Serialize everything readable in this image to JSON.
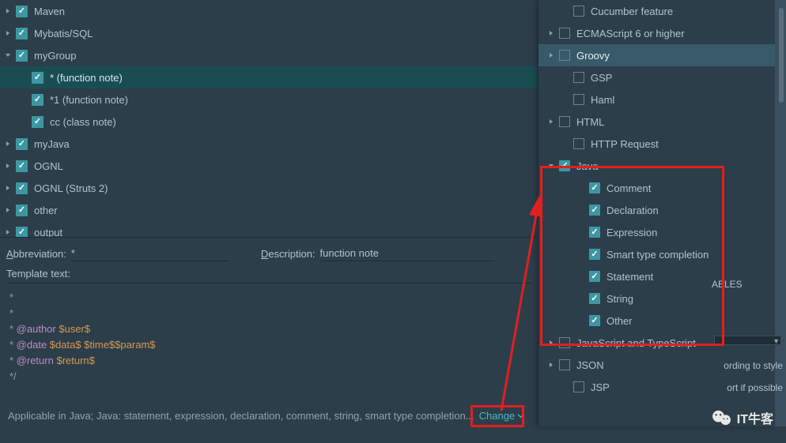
{
  "tree": {
    "items": [
      {
        "label": "Maven",
        "checked": true,
        "hasChevron": true,
        "expanded": false,
        "indent": 0
      },
      {
        "label": "Mybatis/SQL",
        "checked": true,
        "hasChevron": true,
        "expanded": false,
        "indent": 0
      },
      {
        "label": "myGroup",
        "checked": true,
        "hasChevron": true,
        "expanded": true,
        "indent": 0
      },
      {
        "label": "* (function note)",
        "checked": true,
        "hasChevron": false,
        "indent": 1,
        "selected": true
      },
      {
        "label": "*1 (function note)",
        "checked": true,
        "hasChevron": false,
        "indent": 1
      },
      {
        "label": "cc (class note)",
        "checked": true,
        "hasChevron": false,
        "indent": 1
      },
      {
        "label": "myJava",
        "checked": true,
        "hasChevron": true,
        "expanded": false,
        "indent": 0
      },
      {
        "label": "OGNL",
        "checked": true,
        "hasChevron": true,
        "expanded": false,
        "indent": 0
      },
      {
        "label": "OGNL (Struts 2)",
        "checked": true,
        "hasChevron": true,
        "expanded": false,
        "indent": 0
      },
      {
        "label": "other",
        "checked": true,
        "hasChevron": true,
        "expanded": false,
        "indent": 0
      },
      {
        "label": "output",
        "checked": true,
        "hasChevron": true,
        "expanded": false,
        "indent": 0
      }
    ]
  },
  "form": {
    "abbreviation_label_pre": "A",
    "abbreviation_label_post": "bbreviation:",
    "abbreviation_value": "*",
    "description_label_pre": "D",
    "description_label_post": "escription:",
    "description_value": "function note",
    "template_label_pre": "T",
    "template_label_post": "emplate text:"
  },
  "template_lines": [
    {
      "parts": [
        {
          "t": "*",
          "c": "pl-comment"
        }
      ]
    },
    {
      "parts": [
        {
          "t": " *",
          "c": "pl-comment"
        }
      ]
    },
    {
      "parts": [
        {
          "t": " * ",
          "c": "pl-comment"
        },
        {
          "t": "@author",
          "c": "pl-tag"
        },
        {
          "t": " ",
          "c": ""
        },
        {
          "t": "$user$",
          "c": "pl-var"
        }
      ]
    },
    {
      "parts": [
        {
          "t": " * ",
          "c": "pl-comment"
        },
        {
          "t": "@date",
          "c": "pl-tag"
        },
        {
          "t": " ",
          "c": ""
        },
        {
          "t": "$data$ $time$$param$",
          "c": "pl-var"
        }
      ]
    },
    {
      "parts": [
        {
          "t": " * ",
          "c": "pl-comment"
        },
        {
          "t": "@return",
          "c": "pl-tag"
        },
        {
          "t": " ",
          "c": ""
        },
        {
          "t": "$return$",
          "c": "pl-var"
        }
      ]
    },
    {
      "parts": [
        {
          "t": " */",
          "c": "pl-comment"
        }
      ]
    }
  ],
  "applicable": {
    "text": "Applicable in Java; Java: statement, expression, declaration, comment, string, smart type completion...",
    "change": "Change"
  },
  "popup": {
    "items": [
      {
        "label": "Cucumber feature",
        "checked": false,
        "hasChevron": false,
        "indent": 1
      },
      {
        "label": "ECMAScript 6 or higher",
        "checked": false,
        "hasChevron": true,
        "indent": 0
      },
      {
        "label": "Groovy",
        "checked": false,
        "hasChevron": true,
        "indent": 0,
        "selected": true
      },
      {
        "label": "GSP",
        "checked": false,
        "hasChevron": false,
        "indent": 1
      },
      {
        "label": "Haml",
        "checked": false,
        "hasChevron": false,
        "indent": 1
      },
      {
        "label": "HTML",
        "checked": false,
        "hasChevron": true,
        "indent": 0
      },
      {
        "label": "HTTP Request",
        "checked": false,
        "hasChevron": false,
        "indent": 1
      },
      {
        "label": "Java",
        "checked": true,
        "hasChevron": true,
        "expanded": true,
        "indent": 0
      },
      {
        "label": "Comment",
        "checked": true,
        "hasChevron": false,
        "indent": 2
      },
      {
        "label": "Declaration",
        "checked": true,
        "hasChevron": false,
        "indent": 2
      },
      {
        "label": "Expression",
        "checked": true,
        "hasChevron": false,
        "indent": 2
      },
      {
        "label": "Smart type completion",
        "checked": true,
        "hasChevron": false,
        "indent": 2
      },
      {
        "label": "Statement",
        "checked": true,
        "hasChevron": false,
        "indent": 2
      },
      {
        "label": "String",
        "checked": true,
        "hasChevron": false,
        "indent": 2
      },
      {
        "label": "Other",
        "checked": true,
        "hasChevron": false,
        "indent": 2
      },
      {
        "label": "JavaScript and TypeScript",
        "checked": false,
        "hasChevron": true,
        "indent": 0
      },
      {
        "label": "JSON",
        "checked": false,
        "hasChevron": true,
        "indent": 0
      },
      {
        "label": "JSP",
        "checked": false,
        "hasChevron": false,
        "indent": 1
      }
    ]
  },
  "side": {
    "ables": "ABLES",
    "line1": "ording to style",
    "line2": "ort if possible"
  },
  "watermark": "IT牛客"
}
